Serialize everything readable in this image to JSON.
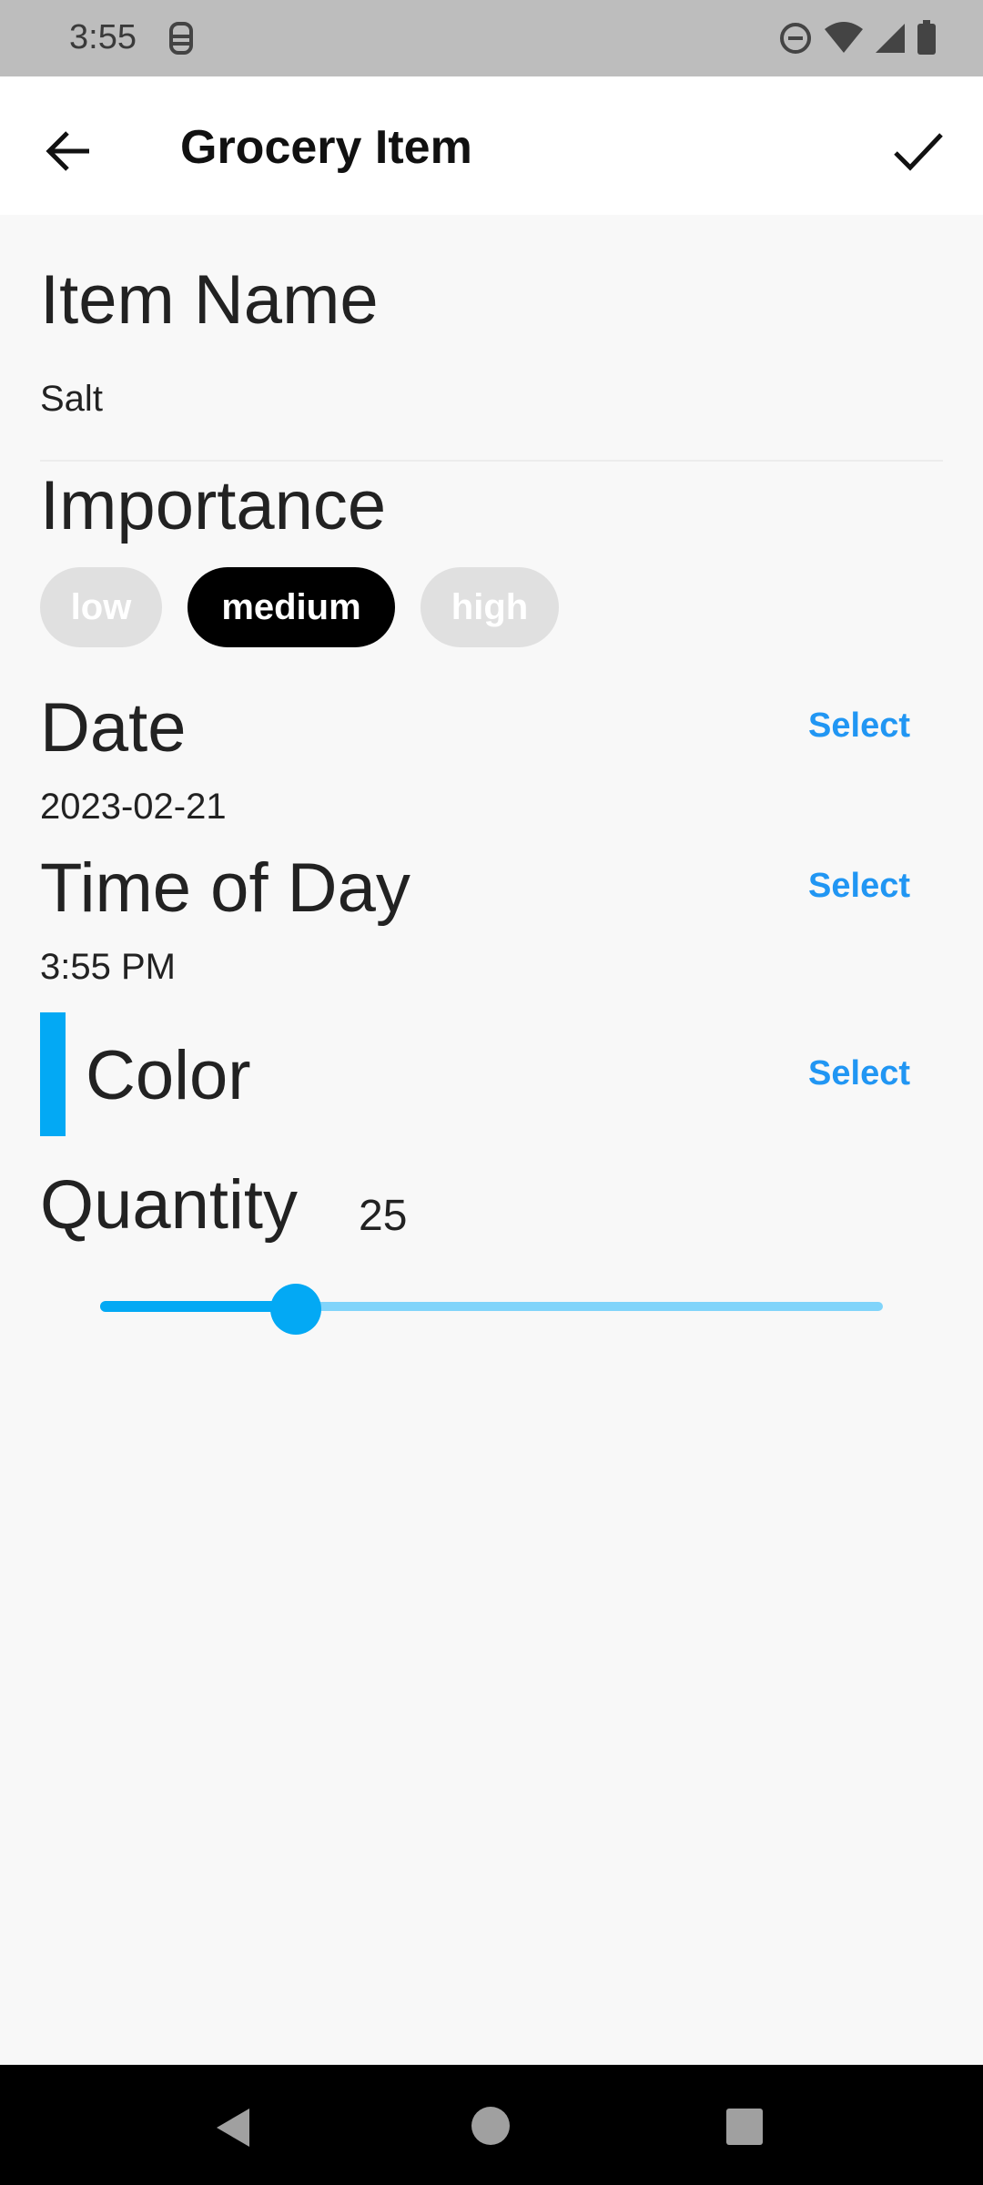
{
  "status_bar": {
    "time": "3:55",
    "icons": [
      "sim-card-icon",
      "do-not-disturb-icon",
      "wifi-icon",
      "cellular-signal-icon",
      "battery-icon"
    ]
  },
  "app_bar": {
    "title": "Grocery Item",
    "back_icon": "arrow-back-icon",
    "save_icon": "check-icon"
  },
  "item_name": {
    "heading": "Item Name",
    "value": "Salt"
  },
  "importance": {
    "heading": "Importance",
    "options": [
      "low",
      "medium",
      "high"
    ],
    "selected": "medium"
  },
  "date": {
    "heading": "Date",
    "value": "2023-02-21",
    "select_label": "Select"
  },
  "time_of_day": {
    "heading": "Time of Day",
    "value": "3:55 PM",
    "select_label": "Select"
  },
  "color": {
    "heading": "Color",
    "select_label": "Select",
    "swatch": "#03a9f4"
  },
  "quantity": {
    "heading": "Quantity",
    "value": "25",
    "slider_fraction": 0.25
  },
  "colors": {
    "accent": "#03a9f4",
    "link": "#2196f3",
    "chip_active": "#000000",
    "chip_inactive": "#e0e0e0"
  },
  "nav_bar": {
    "icons": [
      "nav-back-icon",
      "nav-home-icon",
      "nav-recents-icon"
    ]
  }
}
